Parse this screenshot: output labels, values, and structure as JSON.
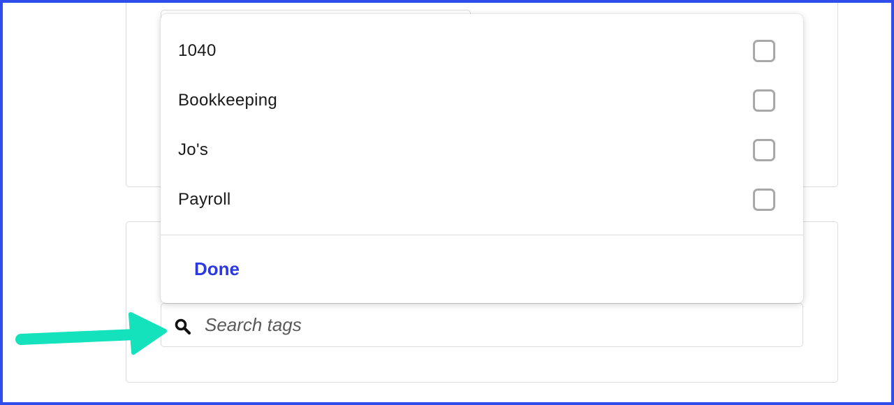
{
  "tag_options": [
    {
      "label": "1040",
      "checked": false
    },
    {
      "label": "Bookkeeping",
      "checked": false
    },
    {
      "label": "Jo's",
      "checked": false
    },
    {
      "label": "Payroll",
      "checked": false
    }
  ],
  "done_label": "Done",
  "search": {
    "placeholder": "Search tags",
    "value": "",
    "icon": "search-icon"
  },
  "colors": {
    "frame": "#2f4dea",
    "done": "#2d39e0",
    "arrow": "#13e2bc",
    "checkbox_border": "#a8a8a8"
  }
}
